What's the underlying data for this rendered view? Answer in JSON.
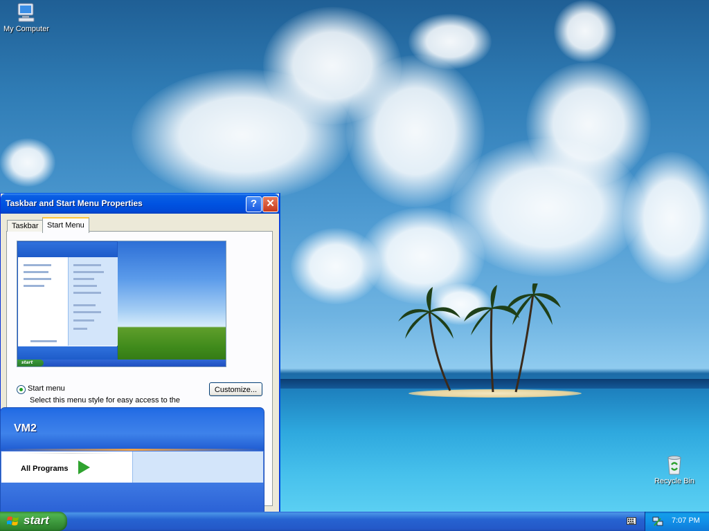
{
  "desktop": {
    "icons": {
      "my_computer": "My Computer",
      "recycle_bin": "Recycle Bin"
    }
  },
  "properties_window": {
    "title": "Taskbar and Start Menu Properties",
    "help_button": "?",
    "close_button": "✕",
    "tabs": [
      "Taskbar",
      "Start Menu"
    ],
    "active_tab": "Start Menu",
    "radio_start_menu_label": "Start menu",
    "radio_start_menu_description": "Select this menu style for easy access to the",
    "customize_button": "Customize..."
  },
  "start_menu": {
    "user": "VM2",
    "all_programs": "All Programs"
  },
  "taskbar": {
    "start_label": "start",
    "clock": "7:07 PM"
  },
  "colors": {
    "taskbar_blue": "#2458c8",
    "start_green": "#3a943a",
    "tray_blue": "#1290e8",
    "window_face": "#ece9d8"
  },
  "icons": [
    "my-computer-icon",
    "recycle-bin-icon",
    "help-icon",
    "close-icon",
    "windows-flag-icon",
    "keyboard-icon",
    "network-icon",
    "all-programs-arrow-icon"
  ]
}
